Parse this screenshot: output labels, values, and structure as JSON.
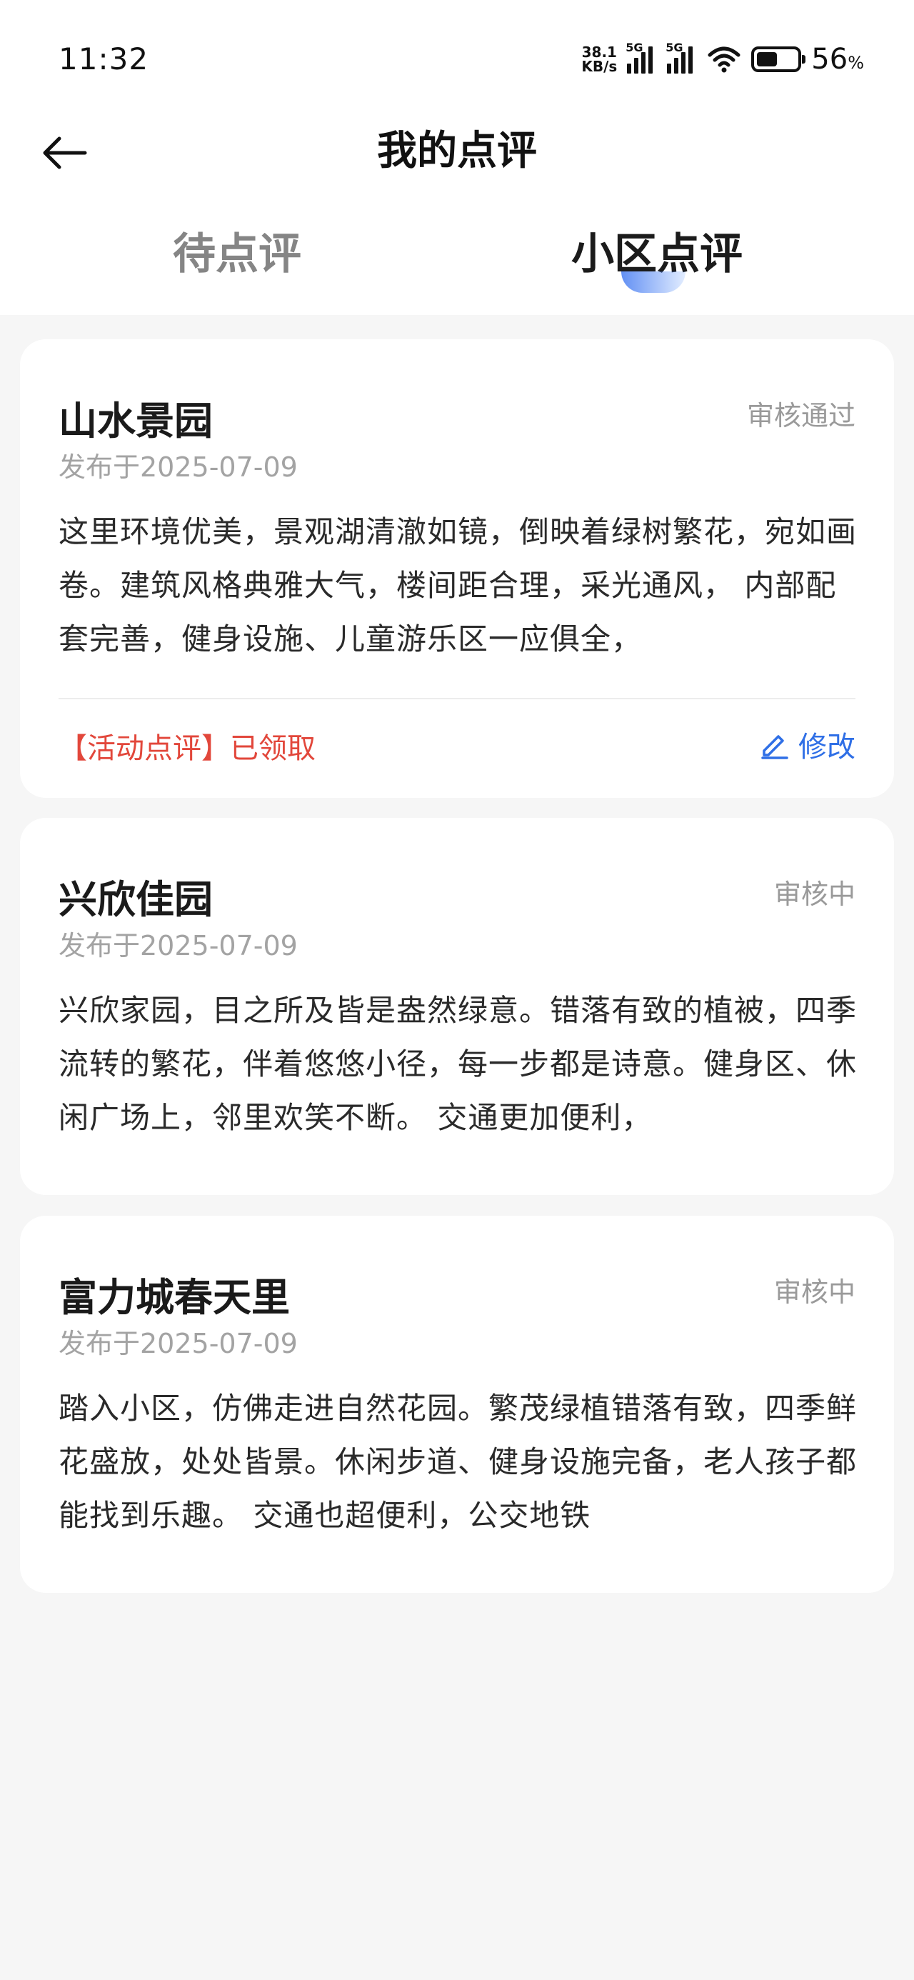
{
  "status_bar": {
    "time": "11:32",
    "net_speed_value": "38.1",
    "net_speed_unit": "KB/s",
    "sim1_type": "5G",
    "sim2_type": "5G",
    "battery_level": "56",
    "battery_unit": "%"
  },
  "header": {
    "title": "我的点评"
  },
  "tabs": [
    {
      "label": "待点评",
      "active": false
    },
    {
      "label": "小区点评",
      "active": true
    }
  ],
  "reviews": [
    {
      "name": "山水景园",
      "status": "审核通过",
      "date": "发布于2025-07-09",
      "text": "这里环境优美，景观湖清澈如镜，倒映着绿树繁花，宛如画卷。建筑风格典雅大气，楼间距合理，采光通风， 内部配套完善，健身设施、儿童游乐区一应俱全，",
      "activity": "【活动点评】已领取",
      "edit_label": "修改"
    },
    {
      "name": "兴欣佳园",
      "status": "审核中",
      "date": "发布于2025-07-09",
      "text": "兴欣家园，目之所及皆是盎然绿意。错落有致的植被，四季流转的繁花，伴着悠悠小径，每一步都是诗意。健身区、休闲广场上，邻里欢笑不断。 交通更加便利，"
    },
    {
      "name": "富力城春天里",
      "status": "审核中",
      "date": "发布于2025-07-09",
      "text": "踏入小区，仿佛走进自然花园。繁茂绿植错落有致，四季鲜花盛放，处处皆景。休闲步道、健身设施完备，老人孩子都能找到乐趣。 交通也超便利，公交地铁"
    }
  ],
  "colors": {
    "accent_blue": "#2f6fe6",
    "activity_red": "#e2473b",
    "background": "#f6f6f6"
  }
}
